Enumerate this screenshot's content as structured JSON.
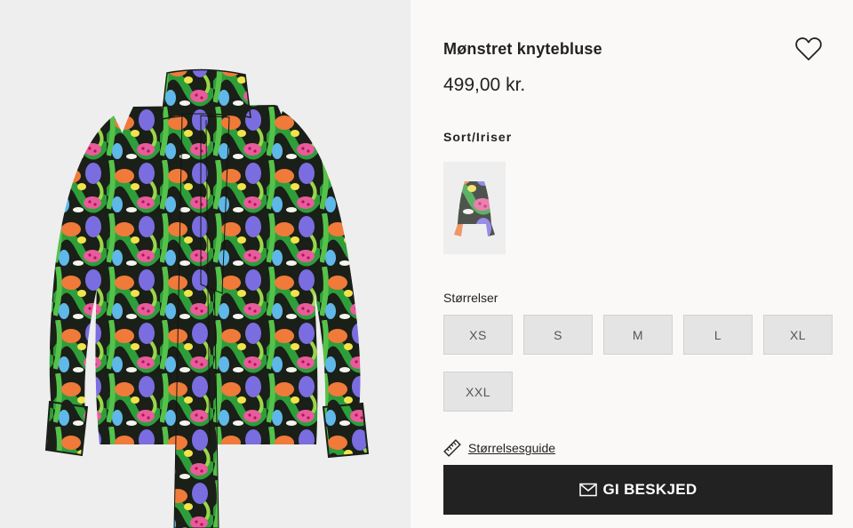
{
  "product": {
    "title": "Mønstret knytebluse",
    "price": "499,00 kr.",
    "image_alt": "product-photo-patterned-tie-blouse",
    "favorite_icon": "heart-outline-icon"
  },
  "colors": {
    "label": "Sort/Iriser",
    "swatches": [
      {
        "name": "Sort/Iriser",
        "selected": true
      }
    ]
  },
  "sizes": {
    "label": "Størrelser",
    "options": [
      "XS",
      "S",
      "M",
      "L",
      "XL",
      "XXL"
    ]
  },
  "size_guide": {
    "label": "Størrelsesguide",
    "icon": "ruler-icon"
  },
  "notify": {
    "label": "GI BESKJED",
    "icon": "envelope-icon"
  },
  "theme": {
    "button_bg": "#222222",
    "size_bg": "#e4e4e4",
    "page_bg": "#faf9f8"
  }
}
